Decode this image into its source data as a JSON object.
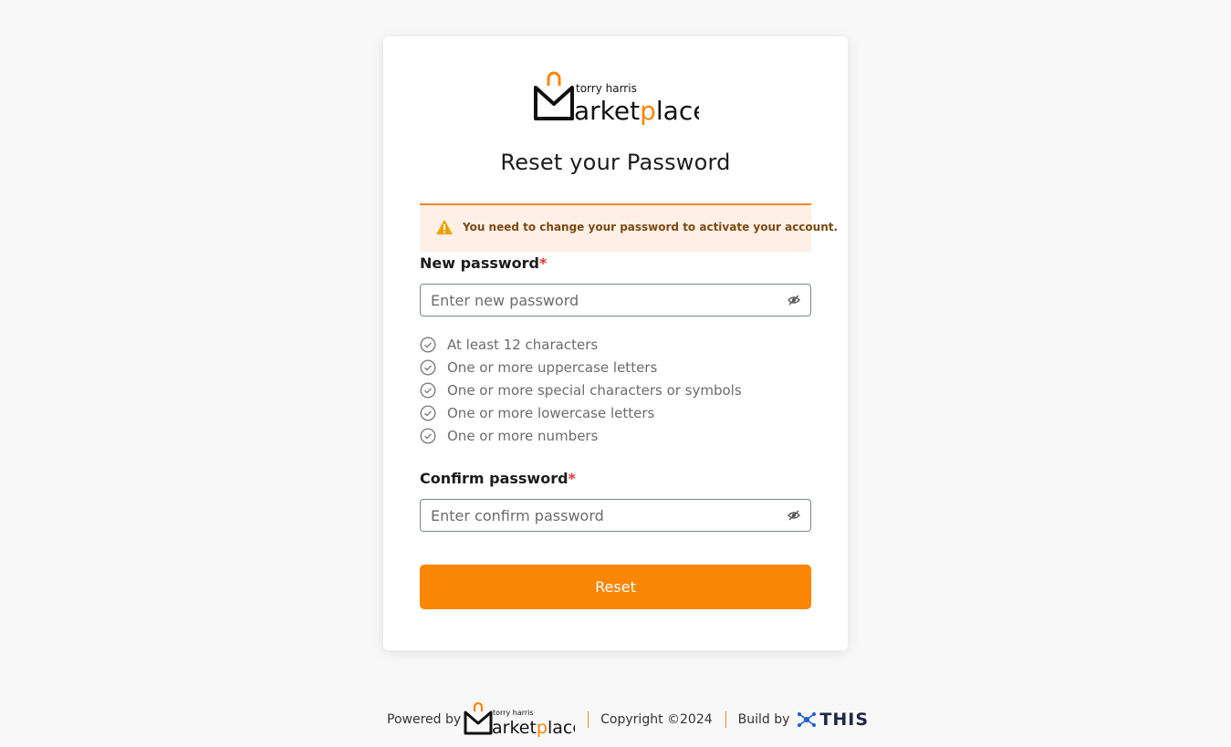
{
  "brand": {
    "name_small": "torry harris",
    "name_large": "Marketplace",
    "accent_color": "#fb8505",
    "dark_color": "#1a1a1a"
  },
  "page": {
    "title": "Reset your Password"
  },
  "alert": {
    "icon": "warning-icon",
    "text": "You need to change your password to activate your account."
  },
  "new_password": {
    "label": "New password",
    "required_mark": "*",
    "placeholder": "Enter new password",
    "value": "",
    "toggle_icon": "eye-slash-icon"
  },
  "rules": [
    {
      "text": "At least 12 characters",
      "icon": "check-circle-icon"
    },
    {
      "text": "One or more uppercase letters",
      "icon": "check-circle-icon"
    },
    {
      "text": "One or more special characters or symbols",
      "icon": "check-circle-icon"
    },
    {
      "text": "One or more lowercase letters",
      "icon": "check-circle-icon"
    },
    {
      "text": "One or more numbers",
      "icon": "check-circle-icon"
    }
  ],
  "confirm_password": {
    "label": "Confirm password",
    "required_mark": "*",
    "placeholder": "Enter confirm password",
    "value": "",
    "toggle_icon": "eye-slash-icon"
  },
  "reset_button": {
    "label": "Reset"
  },
  "footer": {
    "powered_by": "Powered by",
    "copyright": "Copyright ©2024",
    "build_by": "Build by",
    "build_brand": "THIS"
  }
}
